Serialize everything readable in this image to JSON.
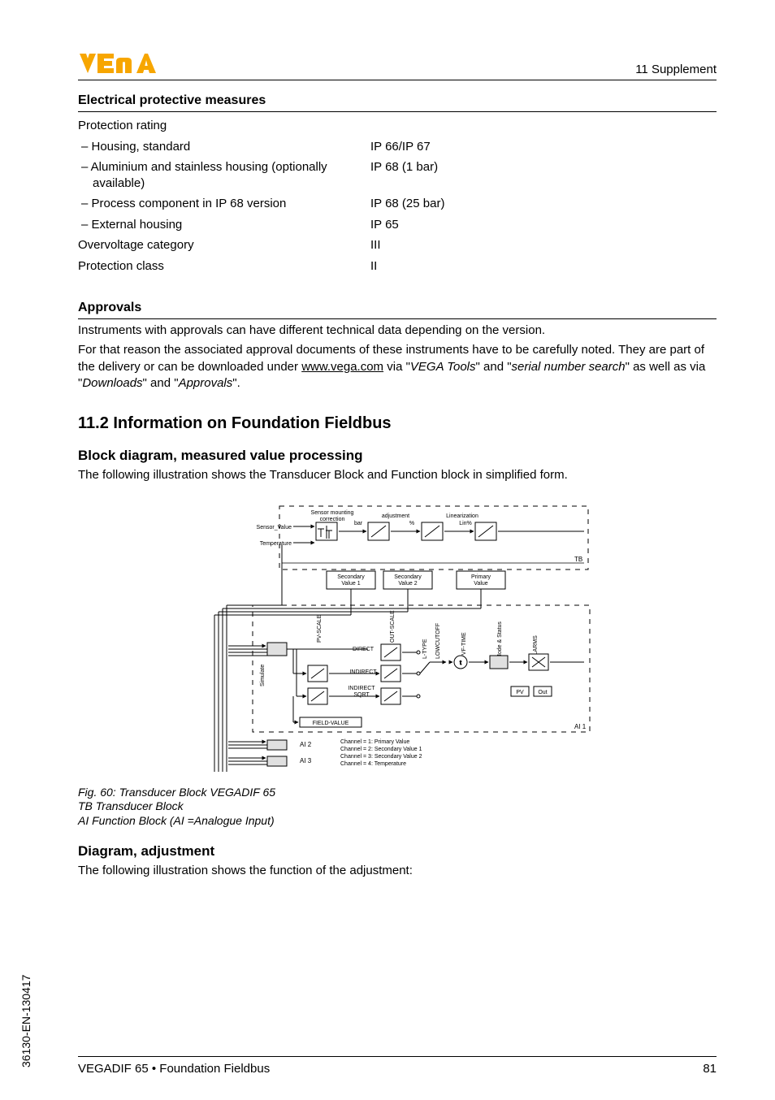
{
  "header": {
    "section_label": "11 Supplement"
  },
  "epm": {
    "title": "Electrical protective measures",
    "protection_rating_label": "Protection rating",
    "rows": [
      {
        "label": "– Housing, standard",
        "value": "IP 66/IP 67"
      },
      {
        "label": "– Aluminium and stainless housing (optionally available)",
        "value": "IP 68 (1 bar)"
      },
      {
        "label": "– Process component in IP 68 version",
        "value": "IP 68 (25 bar)"
      },
      {
        "label": "– External housing",
        "value": "IP 65"
      }
    ],
    "overvoltage_label": "Overvoltage category",
    "overvoltage_value": "III",
    "protection_class_label": "Protection class",
    "protection_class_value": "II"
  },
  "approvals": {
    "title": "Approvals",
    "line1": "Instruments with approvals can have different technical data depending on the version.",
    "line2_pre": "For that reason the associated approval documents of these instruments have to be carefully noted. They are part of the delivery or can be downloaded under ",
    "line2_url": "www.vega.com",
    "line2_mid1": " via \"",
    "line2_tools": "VEGA Tools",
    "line2_mid2": "\" and \"",
    "line2_serial": "serial number search",
    "line2_mid3": "\" as well as via \"",
    "line2_downloads": "Downloads",
    "line2_mid4": "\" and \"",
    "line2_approvals": "Approvals",
    "line2_end": "\"."
  },
  "h2_title": "11.2   Information on Foundation Fieldbus",
  "block_diagram": {
    "title": "Block diagram, measured value processing",
    "intro": "The following illustration shows the Transducer Block and Function block in simplified form.",
    "caption": "Fig. 60: Transducer Block VEGADIF 65",
    "tb": "TB   Transducer Block",
    "ai": "AI    Function Block (AI =Analogue Input)"
  },
  "diagram_adjustment": {
    "title": "Diagram, adjustment",
    "intro": "The following illustration shows the function of the adjustment:"
  },
  "chart_data": {
    "type": "diagram",
    "tb_block": {
      "inputs": [
        "Sensor_Value",
        "Temperature"
      ],
      "top_labels": [
        "Sensor mounting correction",
        "adjustment",
        "Linearization"
      ],
      "top_units": [
        "bar",
        "%",
        "Lin%"
      ],
      "right_label": "TB",
      "outputs": [
        "Secondary Value 1",
        "Secondary Value 2",
        "Primary Value"
      ]
    },
    "ai_block": {
      "left_label": "Simulate",
      "vertical_labels": [
        "PV-SCALE",
        "OUT-SCALE",
        "L-TYPE",
        "LOWCUTOFF",
        "PVF-TIME",
        "Mode & Status",
        "ALARMS"
      ],
      "modes": [
        "DIRECT",
        "INDIRECT",
        "INDIRECT SQRT"
      ],
      "field": "FIELD-VALUE",
      "right_boxes": [
        "PV",
        "Out"
      ],
      "right_label": "AI 1"
    },
    "ai_siblings": [
      "AI 2",
      "AI 3"
    ],
    "channel_map": [
      "Channel = 1: Primary Value",
      "Channel = 2: Secondary Value 1",
      "Channel = 3: Secondary Value 2",
      "Channel = 4: Temperature"
    ]
  },
  "vertical_code": "36130-EN-130417",
  "footer": {
    "left": "VEGADIF 65 • Foundation Fieldbus",
    "right": "81"
  }
}
